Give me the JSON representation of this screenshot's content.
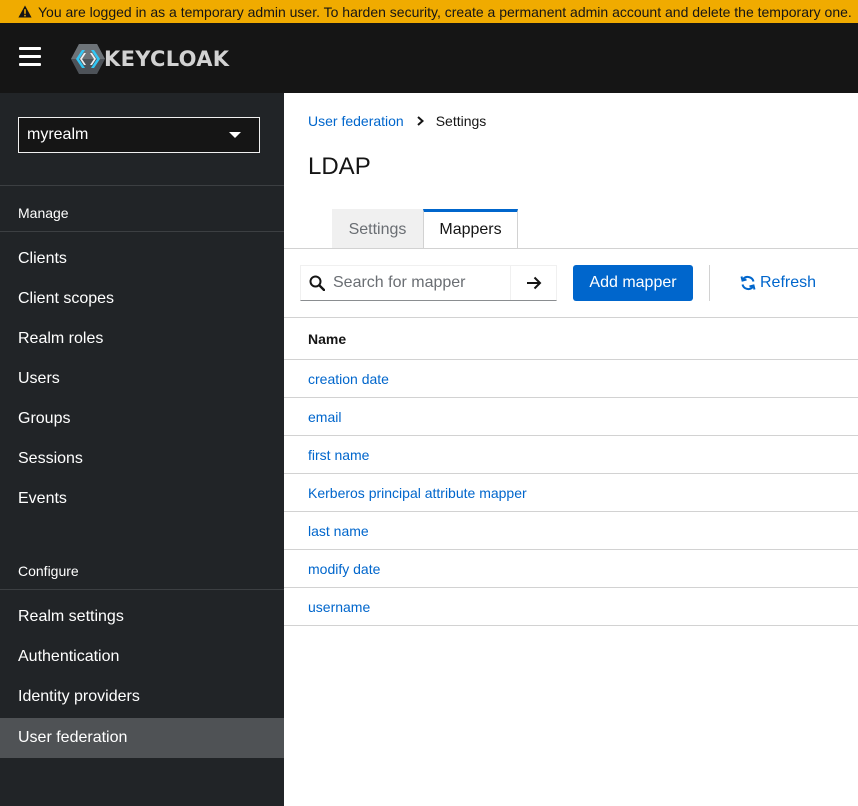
{
  "banner": {
    "text": "You are logged in as a temporary admin user. To harden security, create a permanent admin account and delete the temporary one."
  },
  "masthead": {
    "logo_text": "KEYCLOAK"
  },
  "sidebar": {
    "realm": "myrealm",
    "manage_title": "Manage",
    "manage_items": [
      "Clients",
      "Client scopes",
      "Realm roles",
      "Users",
      "Groups",
      "Sessions",
      "Events"
    ],
    "configure_title": "Configure",
    "configure_items": [
      "Realm settings",
      "Authentication",
      "Identity providers",
      "User federation"
    ],
    "active_item": "User federation"
  },
  "breadcrumb": {
    "parent": "User federation",
    "current": "Settings"
  },
  "page": {
    "title": "LDAP"
  },
  "tabs": {
    "settings": "Settings",
    "mappers": "Mappers",
    "active": "Mappers"
  },
  "toolbar": {
    "search_placeholder": "Search for mapper",
    "add_label": "Add mapper",
    "refresh_label": "Refresh"
  },
  "table": {
    "header": "Name",
    "rows": [
      "creation date",
      "email",
      "first name",
      "Kerberos principal attribute mapper",
      "last name",
      "modify date",
      "username"
    ]
  },
  "colors": {
    "accent": "#0066cc",
    "banner": "#f0ab00",
    "masthead": "#151515",
    "sidebar": "#212427"
  }
}
